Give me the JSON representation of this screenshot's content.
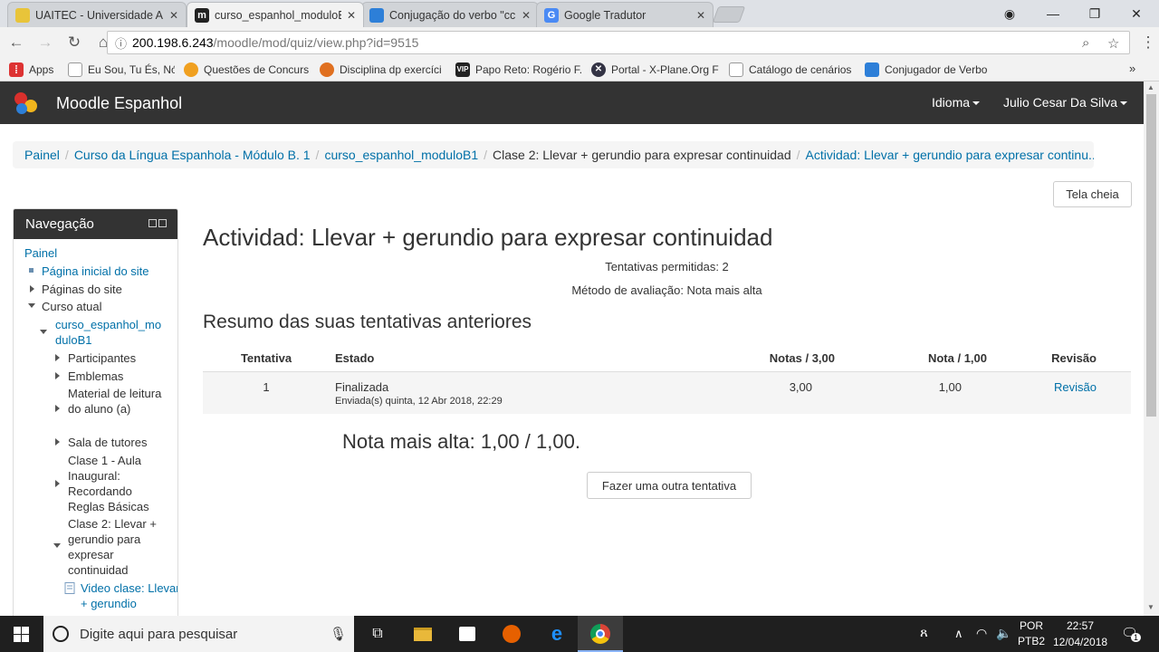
{
  "browser": {
    "tabs": [
      {
        "title": "UAITEC - Universidade A",
        "active": false,
        "favicon_color": "#e8c43a"
      },
      {
        "title": "curso_espanhol_moduloE",
        "active": true,
        "favicon_color": "#222222"
      },
      {
        "title": "Conjugação do verbo \"cc",
        "active": false,
        "favicon_color": "#2d7fd8"
      },
      {
        "title": "Google Tradutor",
        "active": false,
        "favicon_color": "#4a8af4"
      }
    ],
    "url_host": "200.198.6.243",
    "url_path": "/moodle/mod/quiz/view.php?id=9515",
    "bookmarks": [
      {
        "label": "Apps",
        "icon": "apps-grid-icon",
        "color": "#e44"
      },
      {
        "label": "Eu Sou, Tu És, Nós So",
        "icon": "page-icon",
        "color": "#888"
      },
      {
        "label": "Questões de Concurs",
        "icon": "qc-icon",
        "color": "#f0a020"
      },
      {
        "label": "Disciplina dp exercíci",
        "icon": "dp-icon",
        "color": "#e07020"
      },
      {
        "label": "Papo Reto: Rogério F.",
        "icon": "vip-icon",
        "color": "#222"
      },
      {
        "label": "Portal - X-Plane.Org F",
        "icon": "xplane-icon",
        "color": "#334"
      },
      {
        "label": "Catálogo de cenários",
        "icon": "page-icon",
        "color": "#888"
      },
      {
        "label": "Conjugador de Verbo",
        "icon": "conj-icon",
        "color": "#2d7fd8"
      }
    ]
  },
  "navbar": {
    "brand": "Moodle Espanhol",
    "language_menu": "Idioma",
    "user_menu": "Julio Cesar Da Silva"
  },
  "breadcrumb": [
    {
      "label": "Painel",
      "link": true
    },
    {
      "label": "Curso da Língua Espanhola - Módulo B. 1",
      "link": true
    },
    {
      "label": "curso_espanhol_moduloB1",
      "link": true
    },
    {
      "label": "Clase 2: Llevar + gerundio para expresar continuidad",
      "link": false
    },
    {
      "label": "Actividad: Llevar + gerundio para expresar continu...",
      "link": true
    }
  ],
  "fullscreen_button": "Tela cheia",
  "nav_block": {
    "title": "Navegação",
    "items": [
      {
        "label": "Painel"
      },
      {
        "label": "Página inicial do site"
      },
      {
        "label": "Páginas do site"
      },
      {
        "label": "Curso atual"
      },
      {
        "label": "curso_espanhol_mo duloB1"
      },
      {
        "label": "Participantes"
      },
      {
        "label": "Emblemas"
      },
      {
        "label": "Material de leitura do aluno (a)"
      },
      {
        "label": "Sala de tutores"
      },
      {
        "label": "Clase 1 - Aula Inaugural: Recordando Reglas Básicas"
      },
      {
        "label": "Clase 2: Llevar + gerundio para expresar continuidad"
      },
      {
        "label": "Video clase: Llevar + gerundio"
      }
    ]
  },
  "quiz": {
    "title": "Actividad: Llevar + gerundio para expresar continuidad",
    "attempts_allowed": "Tentativas permitidas: 2",
    "grading_method": "Método de avaliação: Nota mais alta",
    "summary_title": "Resumo das suas tentativas anteriores",
    "columns": [
      "Tentativa",
      "Estado",
      "Notas / 3,00",
      "Nota / 1,00",
      "Revisão"
    ],
    "rows": [
      {
        "attempt": "1",
        "state": "Finalizada",
        "submitted": "Enviada(s) quinta, 12 Abr 2018, 22:29",
        "marks": "3,00",
        "grade": "1,00",
        "review": "Revisão"
      }
    ],
    "best_grade": "Nota mais alta: 1,00 / 1,00.",
    "retry_button": "Fazer uma outra tentativa"
  },
  "taskbar": {
    "search_placeholder": "Digite aqui para pesquisar",
    "lang_top": "POR",
    "lang_bottom": "PTB2",
    "time": "22:57",
    "date": "12/04/2018",
    "notification_count": "1"
  },
  "colors": {
    "link": "#0070a8",
    "navbar_bg": "#333333"
  }
}
